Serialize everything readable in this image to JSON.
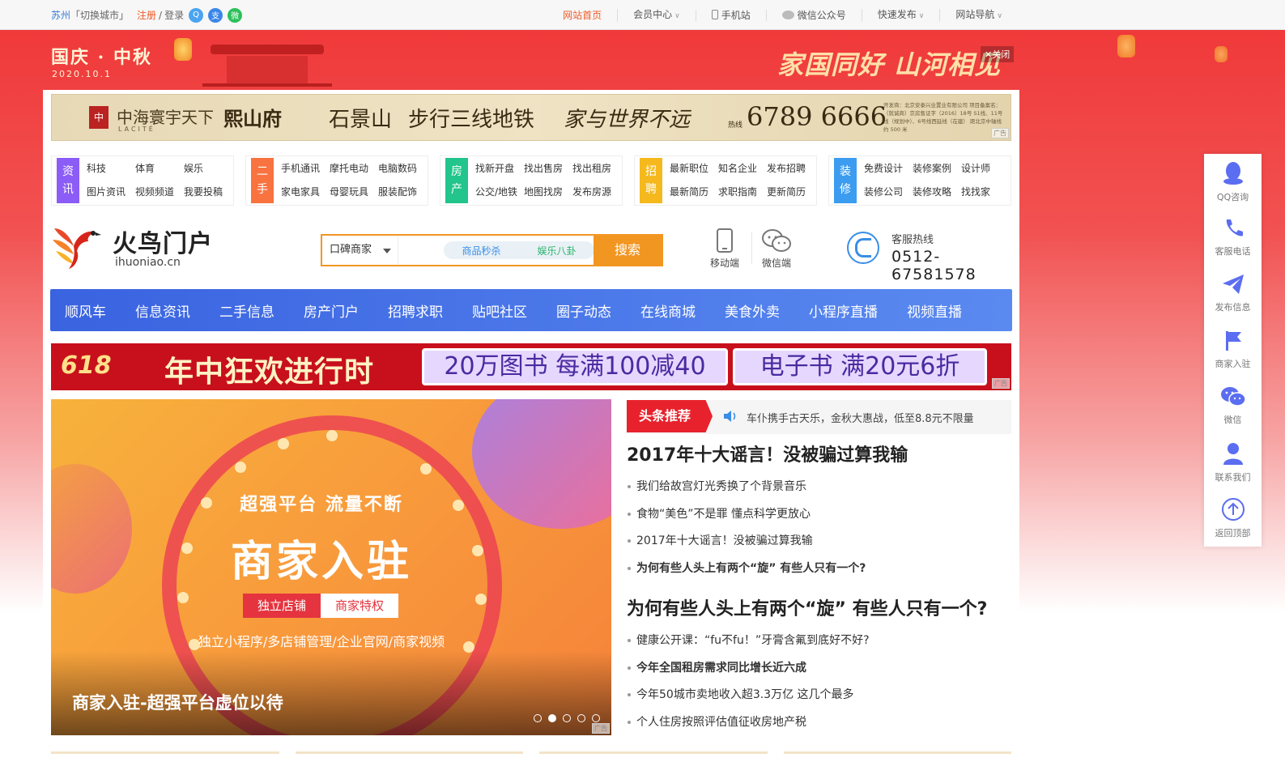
{
  "topbar": {
    "city": "苏州",
    "switch_city": "「切换城市」",
    "register": "注册",
    "sep": "/",
    "login": "登录",
    "links": [
      {
        "label": "网站首页",
        "dropdown": false
      },
      {
        "label": "会员中心",
        "dropdown": true
      },
      {
        "label": "手机站",
        "dropdown": false
      },
      {
        "label": "微信公众号",
        "dropdown": false
      },
      {
        "label": "快速发布",
        "dropdown": true
      },
      {
        "label": "网站导航",
        "dropdown": true
      }
    ]
  },
  "festive": {
    "title": "国庆 · 中秋",
    "date": "2020.10.1",
    "slogan": "家国同好 山河相见",
    "close": "关闭"
  },
  "ad_top": {
    "brand": "中海寰宇天下",
    "brand_sub": "LACITÉ",
    "project": "熙山府",
    "place": "石景山",
    "slogan_a": "步行三线地铁",
    "slogan_b": "家与世界不远",
    "hotline_label": "热线",
    "phone": "6789 6666",
    "fine_print": "开发商：北京安泰兴业置业有限公司 项目备案名：（就诚商）京房售证字（2016）18号 S1线、11号线（规划中）、6号线西延线（在建） 距北京中轴线约 500 米",
    "tag": "广告"
  },
  "categories": [
    {
      "label": "资讯",
      "color": "#8b5cf6",
      "links": [
        "科技",
        "体育",
        "娱乐",
        "图片资讯",
        "视频频道",
        "我要投稿"
      ]
    },
    {
      "label": "二手",
      "color": "#f97340",
      "links": [
        "手机通讯",
        "摩托电动",
        "电脑数码",
        "家电家具",
        "母婴玩具",
        "服装配饰"
      ]
    },
    {
      "label": "房产",
      "color": "#22c58b",
      "links": [
        "找新开盘",
        "找出售房",
        "找出租房",
        "公交/地铁",
        "地图找房",
        "发布房源"
      ]
    },
    {
      "label": "招聘",
      "color": "#f5b91e",
      "links": [
        "最新职位",
        "知名企业",
        "发布招聘",
        "最新简历",
        "求职指南",
        "更新简历"
      ]
    },
    {
      "label": "装修",
      "color": "#3b9cf0",
      "links": [
        "免费设计",
        "装修案例",
        "设计师",
        "装修公司",
        "装修攻略",
        "找找家"
      ]
    }
  ],
  "logo": {
    "name": "火鸟门户",
    "url": "ihuoniao.cn"
  },
  "search": {
    "type_selected": "口碑商家",
    "tags": [
      "商品秒杀",
      "娱乐八卦"
    ],
    "button": "搜索"
  },
  "qrs": [
    {
      "label": "移动端",
      "icon": "mobile-icon"
    },
    {
      "label": "微信端",
      "icon": "wechat-icon"
    }
  ],
  "hotline": {
    "label": "客服热线",
    "number": "0512-67581578"
  },
  "nav": [
    "顺风车",
    "信息资讯",
    "二手信息",
    "房产门户",
    "招聘求职",
    "贴吧社区",
    "圈子动态",
    "在线商城",
    "美食外卖",
    "小程序直播",
    "视频直播"
  ],
  "ad618": {
    "logo": "618",
    "slogan": "年中狂欢进行时",
    "promo1": "20万图书 每满100减40",
    "promo2": "电子书 满20元6折",
    "tag": "广告"
  },
  "slider": {
    "headline": "超强平台  流量不断",
    "title": "商家入驻",
    "pill1": "独立店铺",
    "pill2": "商家特权",
    "sub": "独立小程序/多店铺管理/企业官网/商家视频",
    "caption": "商家入驻-超强平台虚位以待",
    "slide_count": 5,
    "active_slide": 2,
    "tag": "广告"
  },
  "headlines": {
    "tag": "头条推荐",
    "ticker": "车仆携手古天乐，金秋大惠战，低至8.8元不限量",
    "groups": [
      {
        "title": "2017年十大谣言！没被骗过算我输",
        "items": [
          {
            "text": "我们给故宫灯光秀换了个背景音乐",
            "bold": false
          },
          {
            "text": "食物“美色”不是罪 懂点科学更放心",
            "bold": false
          },
          {
            "text": "2017年十大谣言！没被骗过算我输",
            "bold": false
          },
          {
            "text": "为何有些人头上有两个“旋” 有些人只有一个?",
            "bold": true
          }
        ]
      },
      {
        "title": "为何有些人头上有两个“旋” 有些人只有一个?",
        "items": [
          {
            "text": "健康公开课：“fu不fu！”牙膏含氟到底好不好?",
            "bold": false
          },
          {
            "text": "今年全国租房需求同比增长近六成",
            "bold": true
          },
          {
            "text": "今年50城市卖地收入超3.3万亿 这几个最多",
            "bold": false
          },
          {
            "text": "个人住房按照评估值征收房地产税",
            "bold": false
          }
        ]
      }
    ]
  },
  "sidebar": [
    {
      "label": "QQ咨询",
      "icon": "qq-icon"
    },
    {
      "label": "客服电话",
      "icon": "phone-icon"
    },
    {
      "label": "发布信息",
      "icon": "send-icon"
    },
    {
      "label": "商家入驻",
      "icon": "flag-icon"
    },
    {
      "label": "微信",
      "icon": "wechat-icon"
    },
    {
      "label": "联系我们",
      "icon": "user-icon"
    },
    {
      "label": "返回顶部",
      "icon": "arrow-up-icon"
    }
  ],
  "colors": {
    "accent": "#f29622",
    "nav": "#4a74e8",
    "hot": "#e8222c",
    "sidebar_icon": "#5b6df0"
  }
}
